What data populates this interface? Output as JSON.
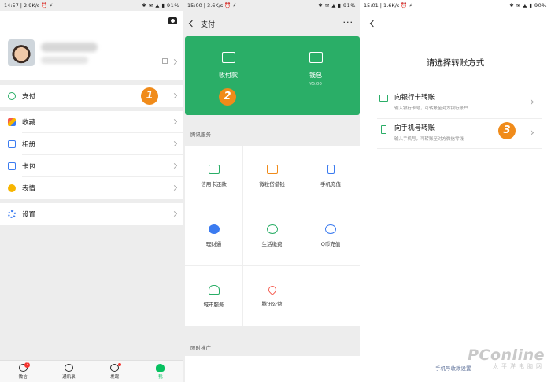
{
  "panel1": {
    "status": {
      "left": "14:57 | 2.9K/s ⏰ ⚡",
      "right": "✱ ✉ ▲ ▮ 91%"
    },
    "menu": [
      {
        "label": "支付",
        "icon": "wallet-check-icon"
      },
      {
        "label": "收藏",
        "icon": "favorites-cube-icon"
      },
      {
        "label": "相册",
        "icon": "album-icon"
      },
      {
        "label": "卡包",
        "icon": "card-wallet-icon"
      },
      {
        "label": "表情",
        "icon": "emoji-icon"
      },
      {
        "label": "设置",
        "icon": "settings-gear-icon"
      }
    ],
    "tabs": [
      {
        "label": "微信",
        "badge": "2"
      },
      {
        "label": "通讯录"
      },
      {
        "label": "发现"
      },
      {
        "label": "我"
      }
    ],
    "marker": "1"
  },
  "panel2": {
    "status": {
      "left": "15:00 | 3.6K/s ⏰ ⚡",
      "right": "✱ ✉ ▲ ▮ 91%"
    },
    "title": "支付",
    "more": "···",
    "actions": [
      {
        "label": "收付款"
      },
      {
        "label": "钱包",
        "sub": "¥5.00"
      }
    ],
    "marker": "2",
    "section_services": "腾讯服务",
    "services": [
      "信用卡还款",
      "微粒贷借钱",
      "手机充值",
      "理财通",
      "生活缴费",
      "Q币充值",
      "城市服务",
      "腾讯公益"
    ],
    "section_promo": "限时推广"
  },
  "panel3": {
    "status": {
      "left": "15:01 | 1.6K/s ⏰ ⚡",
      "right": "✱ ✉ ▲ ▮ 90%"
    },
    "heading": "请选择转账方式",
    "options": [
      {
        "title": "向银行卡转账",
        "sub": "输入银行卡号，可转账至对方银行账户"
      },
      {
        "title": "向手机号转账",
        "sub": "输入手机号，可转账至对方微信零钱"
      }
    ],
    "marker": "3",
    "link": "手机号收款设置",
    "watermark": {
      "brand": "PConline",
      "sub": "太平洋电脑网"
    }
  }
}
